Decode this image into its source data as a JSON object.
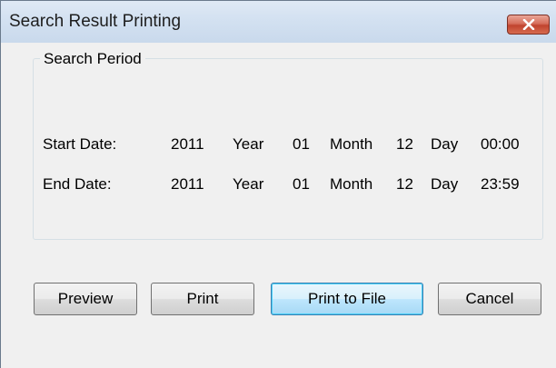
{
  "window": {
    "title": "Search Result Printing",
    "close_icon": "close-icon"
  },
  "search_period": {
    "legend": "Search Period",
    "start": {
      "label": "Start Date:",
      "year": "2011",
      "year_unit": "Year",
      "month": "01",
      "month_unit": "Month",
      "day": "12",
      "day_unit": "Day",
      "time": "00:00"
    },
    "end": {
      "label": "End  Date:",
      "year": "2011",
      "year_unit": "Year",
      "month": "01",
      "month_unit": "Month",
      "day": "12",
      "day_unit": "Day",
      "time": "23:59"
    }
  },
  "buttons": {
    "preview": "Preview",
    "print": "Print",
    "print_to_file": "Print to File",
    "cancel": "Cancel"
  },
  "colors": {
    "titlebar": "#d3e1f1",
    "close_button": "#c0432e",
    "dialog_background": "#f0f0f0",
    "default_button_border": "#3c7fb1"
  }
}
